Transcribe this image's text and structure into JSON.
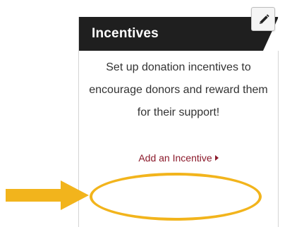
{
  "widget": {
    "title": "Incentives",
    "description": "Set up donation incentives to encourage donors and reward them for their support!",
    "cta_label": "Add an Incentive"
  },
  "edit_button": {
    "icon": "pencil-icon"
  },
  "annotations": {
    "highlight_color": "#f2b41c",
    "arrow_icon": "right-arrow-icon"
  },
  "colors": {
    "header_bg": "#1f1f1f",
    "header_text": "#ffffff",
    "link": "#8b1a2b",
    "body_text": "#333333"
  }
}
